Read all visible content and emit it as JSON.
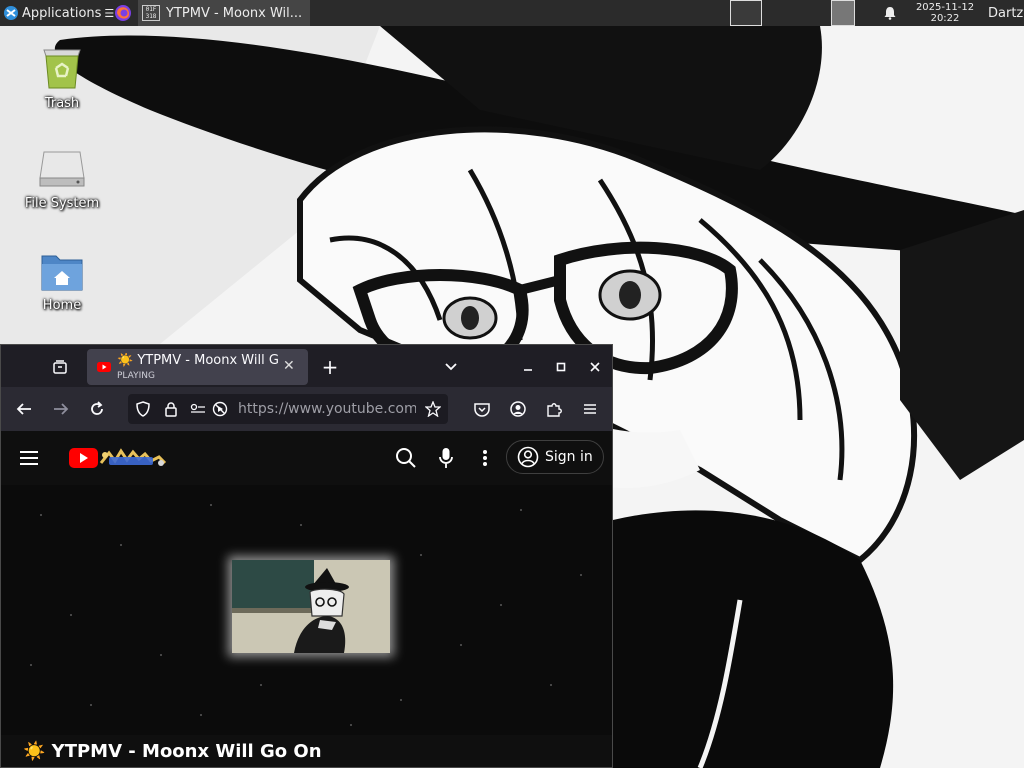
{
  "panel": {
    "applications_label": "Applications",
    "task_title": "YTPMV - Moonx Wil...",
    "clock_date": "2025-11-12",
    "clock_time": "20:22",
    "user": "Dartz"
  },
  "desktop": {
    "icons": [
      {
        "label": "Trash"
      },
      {
        "label": "File System"
      },
      {
        "label": "Home"
      }
    ]
  },
  "browser": {
    "tab_title": "☀️ YTPMV - Moonx Will Go On",
    "tab_status": "PLAYING",
    "url": "https://www.youtube.com",
    "window_controls": {
      "minimize": "–",
      "maximize": "□",
      "close": "✕"
    }
  },
  "youtube": {
    "sign_in_label": "Sign in",
    "video_title": "☀️ YTPMV - Moonx Will Go On"
  },
  "colors": {
    "panel_bg": "#2b2b2b",
    "tab_active": "#42414d",
    "toolbar": "#2b2a33",
    "youtube_red": "#ff0000"
  }
}
